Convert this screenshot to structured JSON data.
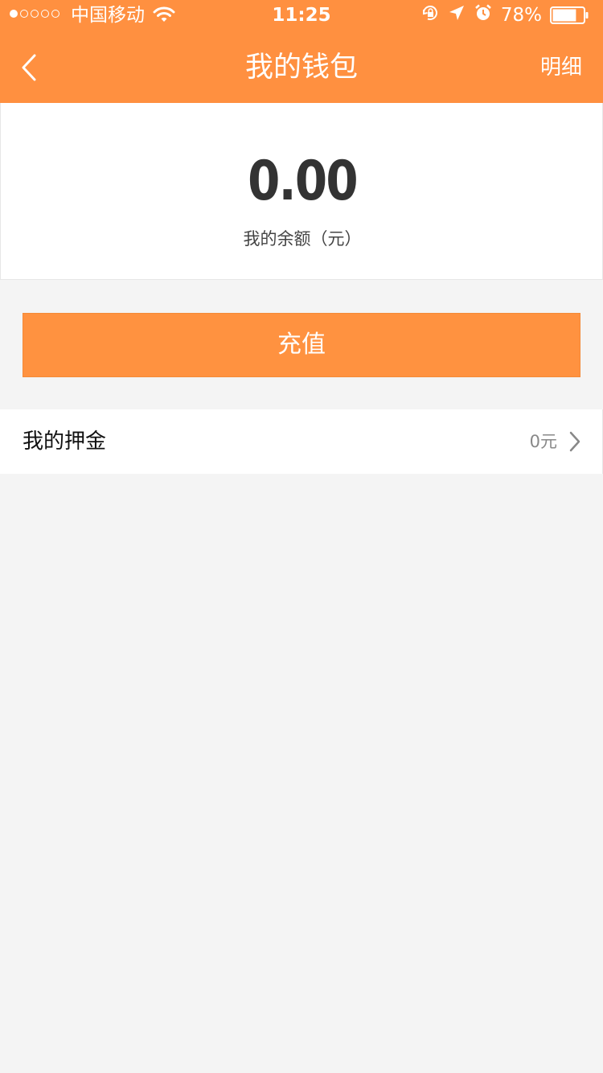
{
  "status_bar": {
    "carrier": "中国移动",
    "time": "11:25",
    "battery_percent": "78%",
    "battery_level": 0.78,
    "signal_strength": 1,
    "signal_max": 5,
    "icons": [
      "wifi-icon",
      "rotation-lock-icon",
      "location-icon",
      "alarm-icon",
      "battery-icon"
    ]
  },
  "nav": {
    "back_icon": "chevron-left-icon",
    "title": "我的钱包",
    "right_action": "明细"
  },
  "balance": {
    "amount": "0.00",
    "label": "我的余额（元）"
  },
  "recharge_button": {
    "label": "充值"
  },
  "deposit": {
    "label": "我的押金",
    "value": "0元",
    "icon": "chevron-right-icon"
  },
  "colors": {
    "accent": "#ff9040",
    "background": "#f4f4f4",
    "card": "#ffffff",
    "amount_text": "#333333"
  }
}
